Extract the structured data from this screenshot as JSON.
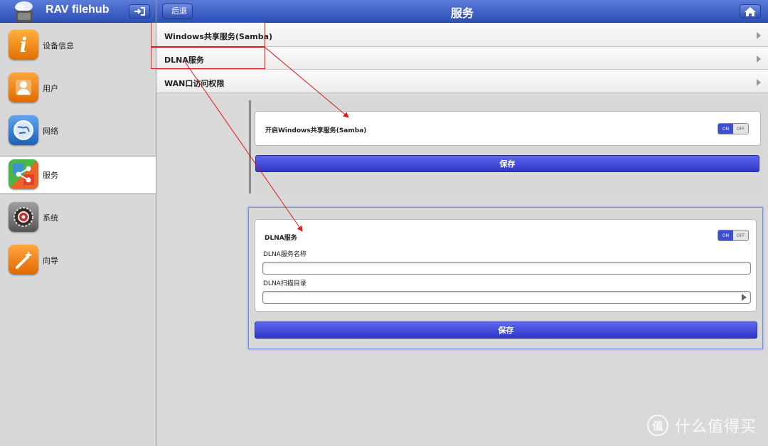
{
  "sidebar": {
    "app_title": "RAV filehub",
    "items": [
      {
        "label": "设备信息",
        "icon": "info-icon"
      },
      {
        "label": "用户",
        "icon": "user-icon"
      },
      {
        "label": "网络",
        "icon": "globe-icon"
      },
      {
        "label": "服务",
        "icon": "share-icon",
        "active": true
      },
      {
        "label": "系统",
        "icon": "system-gear-icon"
      },
      {
        "label": "向导",
        "icon": "wizard-wand-icon"
      }
    ]
  },
  "topbar": {
    "back_label": "后退",
    "title": "服务"
  },
  "services": [
    {
      "label": "Windows共享服务(Samba)"
    },
    {
      "label": "DLNA服务"
    },
    {
      "label": "WAN口访问权限"
    }
  ],
  "samba_panel": {
    "toggle_label": "开启Windows共享服务(Samba)",
    "toggle_on": "ON",
    "toggle_off": "OFF",
    "save_label": "保存"
  },
  "dlna_panel": {
    "title": "DLNA服务",
    "toggle_on": "ON",
    "toggle_off": "OFF",
    "name_label": "DLNA服务名称",
    "name_value": "",
    "dir_label": "DLNA扫描目录",
    "dir_value": "",
    "save_label": "保存"
  },
  "colors": {
    "header_blue": "#3a5cc4",
    "button_blue": "#3b44d8",
    "annotation_red": "#e01919"
  },
  "watermark": {
    "symbol": "值",
    "text": "什么值得买"
  }
}
